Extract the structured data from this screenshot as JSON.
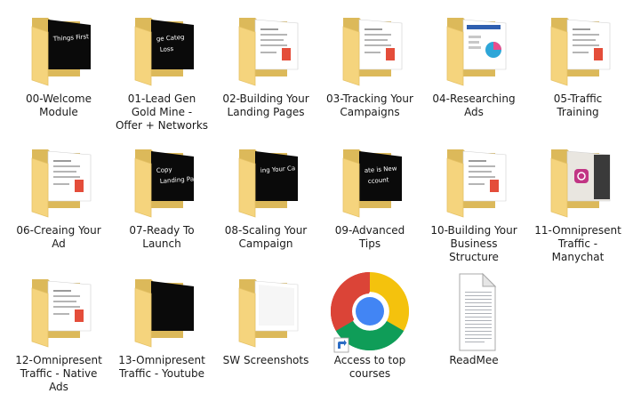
{
  "items": [
    {
      "label": "00-Welcome\nModule",
      "type": "folder",
      "preview": "dark",
      "preview_text": "Things First"
    },
    {
      "label": "01-Lead Gen\nGold Mine -\nOffer + Networks",
      "type": "folder",
      "preview": "dark",
      "preview_text": "ge Categ\nLoss"
    },
    {
      "label": "02-Building Your\nLanding Pages",
      "type": "folder",
      "preview": "doc",
      "preview_text": ""
    },
    {
      "label": "03-Tracking Your\nCampaigns",
      "type": "folder",
      "preview": "doc",
      "preview_text": ""
    },
    {
      "label": "04-Researching\nAds",
      "type": "folder",
      "preview": "chart",
      "preview_text": ""
    },
    {
      "label": "05-Traffic\nTraining",
      "type": "folder",
      "preview": "doc",
      "preview_text": ""
    },
    {
      "label": "06-Creaing Your\nAd",
      "type": "folder",
      "preview": "doc",
      "preview_text": ""
    },
    {
      "label": "07-Ready To\nLaunch",
      "type": "folder",
      "preview": "dark",
      "preview_text": "Copy\nLanding Page"
    },
    {
      "label": "08-Scaling Your\nCampaign",
      "type": "folder",
      "preview": "dark",
      "preview_text": "ing Your Ca"
    },
    {
      "label": "09-Advanced\nTips",
      "type": "folder",
      "preview": "dark",
      "preview_text": "ate is New\nccount"
    },
    {
      "label": "10-Building Your\nBusiness\nStructure",
      "type": "folder",
      "preview": "doc",
      "preview_text": ""
    },
    {
      "label": "11-Omnipresent\nTraffic -\nManychat",
      "type": "folder",
      "preview": "insta",
      "preview_text": ""
    },
    {
      "label": "12-Omnipresent\nTraffic - Native\nAds",
      "type": "folder",
      "preview": "doc",
      "preview_text": ""
    },
    {
      "label": "13-Omnipresent\nTraffic - Youtube",
      "type": "folder",
      "preview": "dark",
      "preview_text": ""
    },
    {
      "label": "SW Screenshots",
      "type": "folder",
      "preview": "blank",
      "preview_text": ""
    },
    {
      "label": "Access to top\ncourses",
      "type": "shortcut",
      "icon": "chrome-icon"
    },
    {
      "label": "ReadMee",
      "type": "file",
      "icon": "text-document-icon"
    }
  ],
  "colors": {
    "folder_back": "#dcb95a",
    "folder_front": "#f5d47d",
    "folder_edge": "#e6c266",
    "chrome_red": "#db4437",
    "chrome_green": "#0f9d58",
    "chrome_yellow": "#f4c20d",
    "chrome_blue": "#4285f4"
  }
}
